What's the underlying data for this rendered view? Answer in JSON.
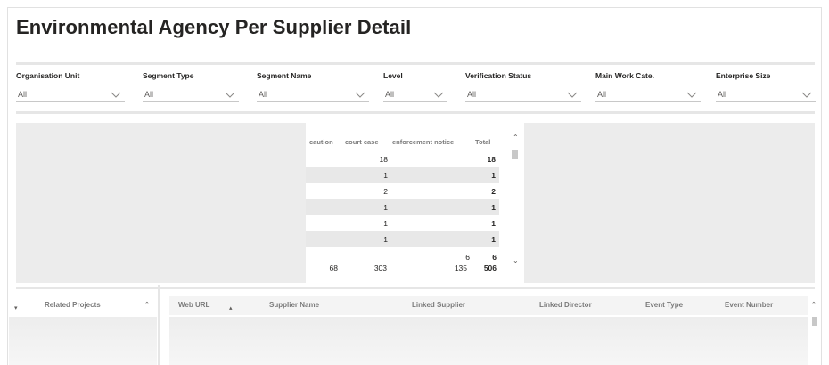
{
  "page": {
    "title": "Environmental Agency Per Supplier Detail"
  },
  "slicers": [
    {
      "label": "Organisation Unit",
      "value": "All"
    },
    {
      "label": "Segment Type",
      "value": "All"
    },
    {
      "label": "Segment Name",
      "value": "All"
    },
    {
      "label": "Level",
      "value": "All"
    },
    {
      "label": "Verification Status",
      "value": "All"
    },
    {
      "label": "Main Work Cate.",
      "value": "All"
    },
    {
      "label": "Enterprise Size",
      "value": "All"
    }
  ],
  "matrix": {
    "headers": [
      "caution",
      "court case",
      "enforcement notice",
      "Total"
    ],
    "rows": [
      {
        "court_case": "18",
        "total": "18"
      },
      {
        "court_case": "1",
        "total": "1"
      },
      {
        "court_case": "2",
        "total": "2"
      },
      {
        "court_case": "1",
        "total": "1"
      },
      {
        "court_case": "1",
        "total": "1"
      },
      {
        "court_case": "1",
        "total": "1"
      }
    ],
    "partial_row": {
      "enforcement": "6",
      "total": "6"
    },
    "totals": {
      "caution": "68",
      "court_case": "303",
      "enforcement": "135",
      "total": "506"
    }
  },
  "left_table": {
    "header": "Related Projects"
  },
  "detail_table": {
    "headers": [
      "Web URL",
      "Supplier Name",
      "Linked Supplier",
      "Linked Director",
      "Event Type",
      "Event Number"
    ]
  },
  "colors": {
    "accent_text": "#252423",
    "panel_gray": "#ececec",
    "header_gray": "#7a7a7a"
  }
}
